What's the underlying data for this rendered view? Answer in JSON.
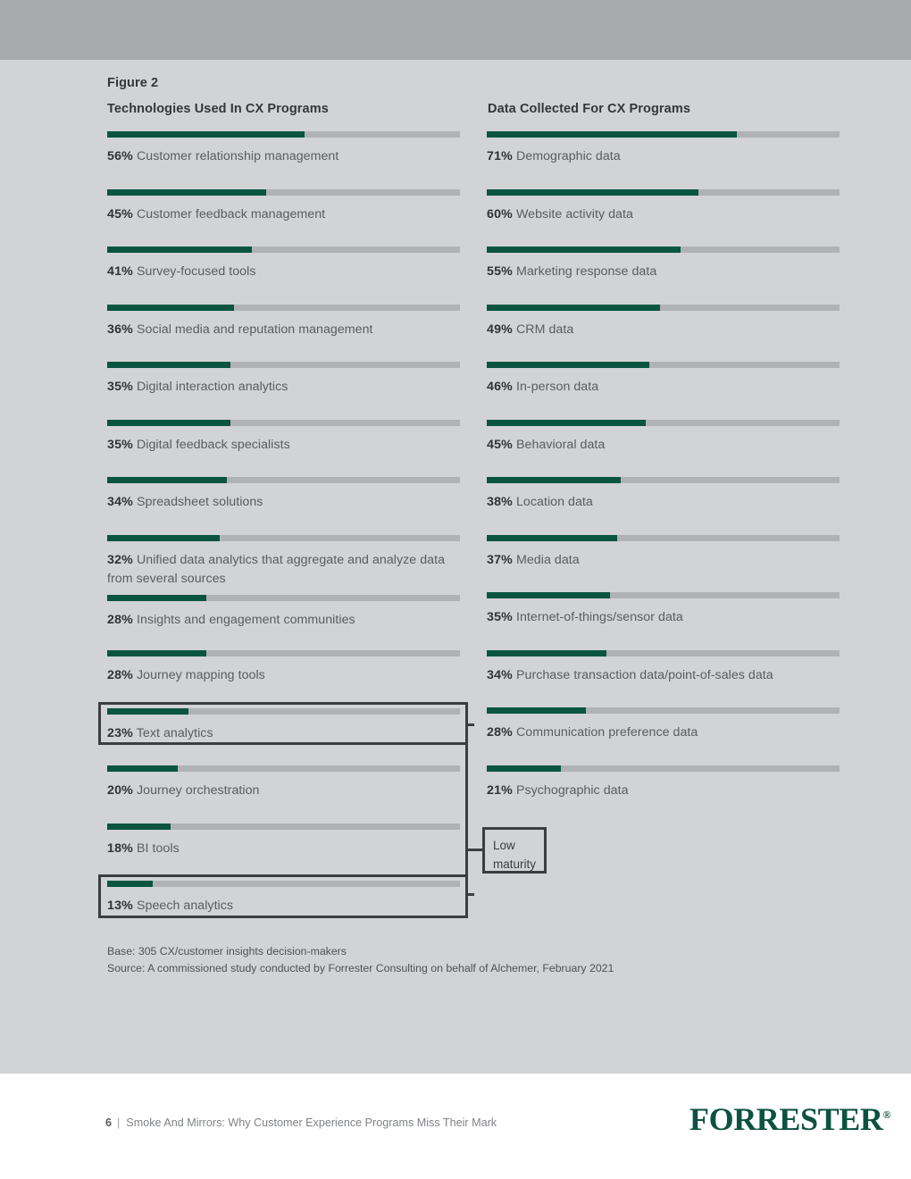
{
  "figure": {
    "label": "Figure 2"
  },
  "columns": [
    {
      "title": "Technologies Used In CX Programs",
      "rows": [
        {
          "pct": "56%",
          "label": "Customer relationship management",
          "value": 56
        },
        {
          "pct": "45%",
          "label": "Customer feedback management",
          "value": 45
        },
        {
          "pct": "41%",
          "label": "Survey-focused tools",
          "value": 41
        },
        {
          "pct": "36%",
          "label": "Social media and reputation management",
          "value": 36
        },
        {
          "pct": "35%",
          "label": "Digital interaction analytics",
          "value": 35
        },
        {
          "pct": "35%",
          "label": "Digital feedback specialists",
          "value": 35
        },
        {
          "pct": "34%",
          "label": "Spreadsheet solutions",
          "value": 34
        },
        {
          "pct": "32%",
          "label": "Unified data analytics that aggregate and analyze data from several sources",
          "value": 32
        },
        {
          "pct": "28%",
          "label": "Insights and engagement communities",
          "value": 28
        },
        {
          "pct": "28%",
          "label": "Journey mapping tools",
          "value": 28
        },
        {
          "pct": "23%",
          "label": "Text analytics",
          "value": 23
        },
        {
          "pct": "20%",
          "label": "Journey orchestration",
          "value": 20
        },
        {
          "pct": "18%",
          "label": "BI tools",
          "value": 18
        },
        {
          "pct": "13%",
          "label": "Speech analytics",
          "value": 13
        }
      ]
    },
    {
      "title": "Data Collected For CX Programs",
      "rows": [
        {
          "pct": "71%",
          "label": "Demographic data",
          "value": 71
        },
        {
          "pct": "60%",
          "label": "Website activity data",
          "value": 60
        },
        {
          "pct": "55%",
          "label": "Marketing response data",
          "value": 55
        },
        {
          "pct": "49%",
          "label": "CRM data",
          "value": 49
        },
        {
          "pct": "46%",
          "label": "In-person data",
          "value": 46
        },
        {
          "pct": "45%",
          "label": "Behavioral data",
          "value": 45
        },
        {
          "pct": "38%",
          "label": "Location data",
          "value": 38
        },
        {
          "pct": "37%",
          "label": "Media data",
          "value": 37
        },
        {
          "pct": "35%",
          "label": "Internet-of-things/sensor data",
          "value": 35
        },
        {
          "pct": "34%",
          "label": "Purchase transaction data/point-of-sales data",
          "value": 34
        },
        {
          "pct": "28%",
          "label": "Communication preference data",
          "value": 28
        },
        {
          "pct": "21%",
          "label": "Psychographic data",
          "value": 21
        }
      ]
    }
  ],
  "callout": {
    "line1": "Low",
    "line2": "maturity"
  },
  "footnotes": {
    "base": "Base: 305 CX/customer insights decision-makers",
    "source": "Source: A commissioned study conducted by Forrester Consulting on behalf of Alchemer, February 2021"
  },
  "footer": {
    "page_number": "6",
    "separator": "|",
    "report_title": "Smoke And Mirrors: Why Customer Experience Programs Miss Their Mark",
    "logo_text": "FORRESTER",
    "logo_mark": "®"
  },
  "colors": {
    "bar_fill": "#0a5540",
    "bar_track": "#b0b2b4",
    "page_background": "#d1d3d4",
    "top_band": "#a8aaad",
    "callout_border": "#3b3d40",
    "brand_green": "#0d5240"
  },
  "chart_data": [
    {
      "type": "bar",
      "title": "Technologies Used In CX Programs",
      "orientation": "horizontal",
      "xlabel": "",
      "ylabel": "",
      "xlim": [
        0,
        100
      ],
      "grid": false,
      "legend": "none",
      "categories": [
        "Customer relationship management",
        "Customer feedback management",
        "Survey-focused tools",
        "Social media and reputation management",
        "Digital interaction analytics",
        "Digital feedback specialists",
        "Spreadsheet solutions",
        "Unified data analytics that aggregate and analyze data from several sources",
        "Insights and engagement communities",
        "Journey mapping tools",
        "Text analytics",
        "Journey orchestration",
        "BI tools",
        "Speech analytics"
      ],
      "values": [
        56,
        45,
        41,
        36,
        35,
        35,
        34,
        32,
        28,
        28,
        23,
        20,
        18,
        13
      ],
      "annotations": [
        "Low maturity bracket groups: Text analytics (23%) and Speech analytics (13%)"
      ]
    },
    {
      "type": "bar",
      "title": "Data Collected For CX Programs",
      "orientation": "horizontal",
      "xlabel": "",
      "ylabel": "",
      "xlim": [
        0,
        100
      ],
      "grid": false,
      "legend": "none",
      "categories": [
        "Demographic data",
        "Website activity data",
        "Marketing response data",
        "CRM data",
        "In-person data",
        "Behavioral data",
        "Location data",
        "Media data",
        "Internet-of-things/sensor data",
        "Purchase transaction data/point-of-sales data",
        "Communication preference data",
        "Psychographic data"
      ],
      "values": [
        71,
        60,
        55,
        49,
        46,
        45,
        38,
        37,
        35,
        34,
        28,
        21
      ]
    }
  ]
}
